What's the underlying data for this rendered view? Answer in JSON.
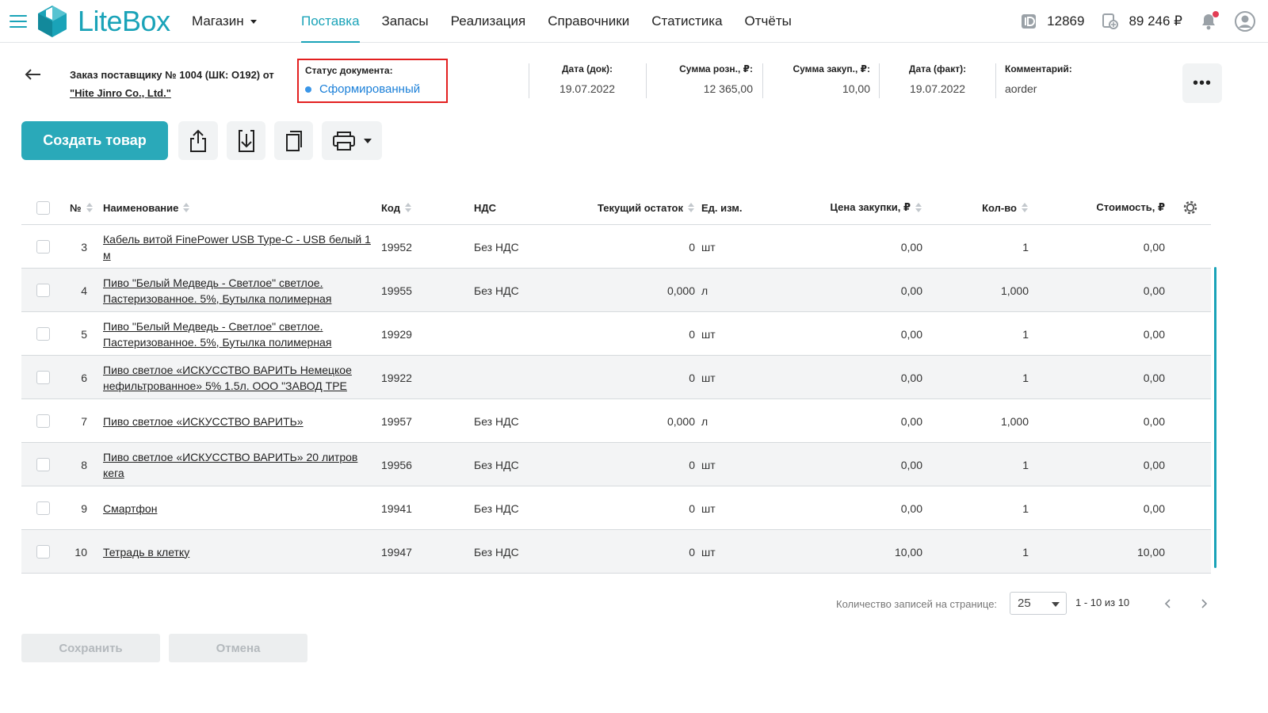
{
  "app": {
    "name": "LiteBox",
    "accent": "#1aa3b8",
    "status_dot": "#3a96e8",
    "highlight": "#e32020"
  },
  "header": {
    "store_label": "Магазин",
    "nav": [
      {
        "label": "Поставка",
        "active": true
      },
      {
        "label": "Запасы"
      },
      {
        "label": "Реализация"
      },
      {
        "label": "Справочники"
      },
      {
        "label": "Статистика"
      },
      {
        "label": "Отчёты"
      }
    ],
    "user_id": "12869",
    "balance": "89 246 ₽"
  },
  "document": {
    "title_line1": "Заказ поставщику № 1004 (ШК: O192) от",
    "supplier": "\"Hite Jinro Co., Ltd.\"",
    "status_label": "Статус документа:",
    "status_value": "Сформированный",
    "date_doc_label": "Дата (док):",
    "date_doc": "19.07.2022",
    "retail_sum_label": "Сумма розн., ₽:",
    "retail_sum": "12 365,00",
    "purchase_sum_label": "Сумма закуп., ₽:",
    "purchase_sum": "10,00",
    "date_fact_label": "Дата (факт):",
    "date_fact": "19.07.2022",
    "comment_label": "Комментарий:",
    "comment": "aorder",
    "more_label": "•••"
  },
  "toolbar": {
    "create_label": "Создать товар"
  },
  "table": {
    "headers": {
      "num": "№",
      "name": "Наименование",
      "code": "Код",
      "vat": "НДС",
      "stock": "Текущий остаток",
      "unit": "Ед. изм.",
      "price": "Цена закупки, ₽",
      "qty": "Кол-во",
      "cost": "Стоимость, ₽"
    },
    "rows": [
      {
        "num": "3",
        "name": "Кабель витой FinePower USB Type-C - USB белый 1 м",
        "code": "19952",
        "vat": "Без НДС",
        "stock": "0",
        "unit": "шт",
        "price": "0,00",
        "qty": "1",
        "cost": "0,00"
      },
      {
        "num": "4",
        "name": "Пиво \"Белый Медведь - Светлое\" светлое. Пастеризованное. 5%, Бутылка полимерная",
        "code": "19955",
        "vat": "Без НДС",
        "stock": "0,000",
        "unit": "л",
        "price": "0,00",
        "qty": "1,000",
        "cost": "0,00"
      },
      {
        "num": "5",
        "name": "Пиво \"Белый Медведь - Светлое\" светлое. Пастеризованное. 5%, Бутылка полимерная",
        "code": "19929",
        "vat": "",
        "stock": "0",
        "unit": "шт",
        "price": "0,00",
        "qty": "1",
        "cost": "0,00"
      },
      {
        "num": "6",
        "name": "Пиво светлое «ИСКУССТВО ВАРИТЬ Немецкое нефильтрованное» 5% 1.5л. ООО \"ЗАВОД ТРЕ",
        "code": "19922",
        "vat": "",
        "stock": "0",
        "unit": "шт",
        "price": "0,00",
        "qty": "1",
        "cost": "0,00"
      },
      {
        "num": "7",
        "name": "Пиво светлое «ИСКУССТВО ВАРИТЬ»",
        "code": "19957",
        "vat": "Без НДС",
        "stock": "0,000",
        "unit": "л",
        "price": "0,00",
        "qty": "1,000",
        "cost": "0,00"
      },
      {
        "num": "8",
        "name": "Пиво светлое «ИСКУССТВО ВАРИТЬ» 20 литров кега",
        "code": "19956",
        "vat": "Без НДС",
        "stock": "0",
        "unit": "шт",
        "price": "0,00",
        "qty": "1",
        "cost": "0,00"
      },
      {
        "num": "9",
        "name": "Смартфон",
        "code": "19941",
        "vat": "Без НДС",
        "stock": "0",
        "unit": "шт",
        "price": "0,00",
        "qty": "1",
        "cost": "0,00"
      },
      {
        "num": "10",
        "name": "Тетрадь в клетку",
        "code": "19947",
        "vat": "Без НДС",
        "stock": "0",
        "unit": "шт",
        "price": "10,00",
        "qty": "1",
        "cost": "10,00"
      }
    ]
  },
  "pagination": {
    "per_page_label": "Количество записей на странице:",
    "per_page": "25",
    "range": "1 - 10 из 10"
  },
  "footer": {
    "save_label": "Сохранить",
    "cancel_label": "Отмена"
  }
}
